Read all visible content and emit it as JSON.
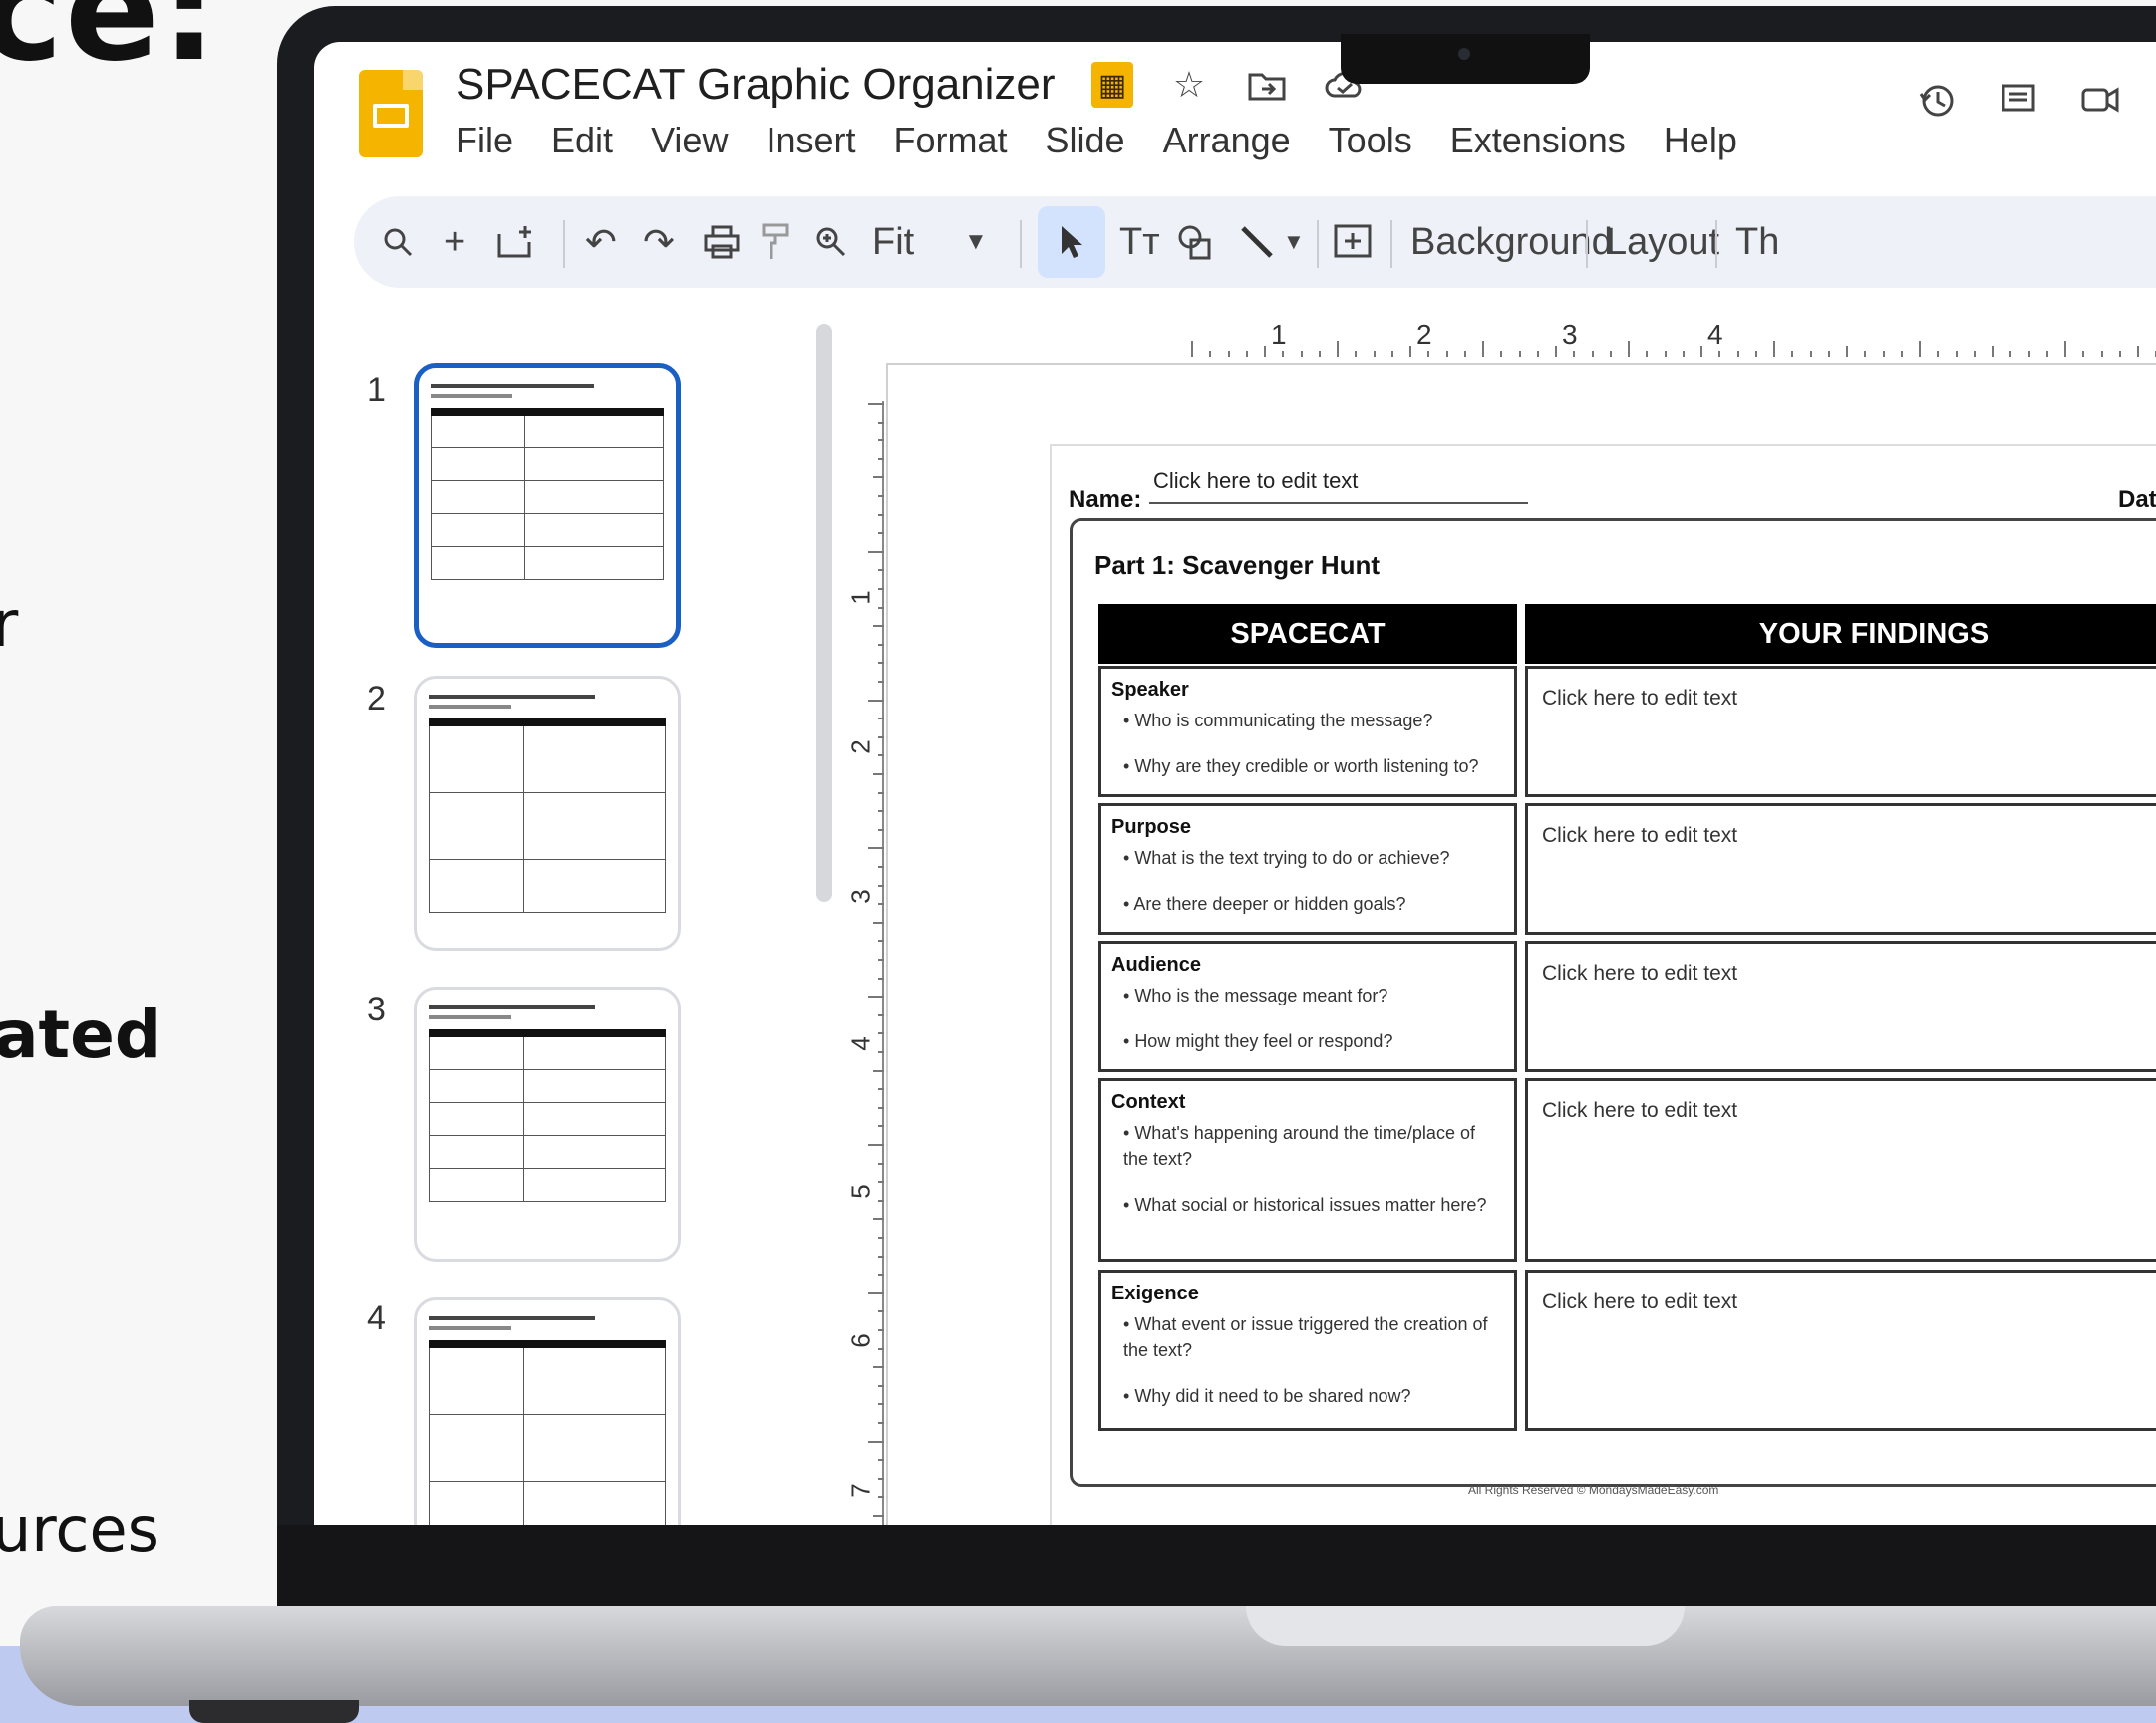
{
  "side_text": {
    "top": "ce:",
    "r": "r",
    "ated": "ated",
    "urces": "urces"
  },
  "app": {
    "title": "SPACECAT Graphic Organizer",
    "menu": [
      "File",
      "Edit",
      "View",
      "Insert",
      "Format",
      "Slide",
      "Arrange",
      "Tools",
      "Extensions",
      "Help"
    ]
  },
  "toolbar": {
    "zoom_label": "Fit",
    "background_label": "Background",
    "layout_label": "Layout",
    "theme_label": "Th"
  },
  "filmstrip": {
    "numbers": [
      "1",
      "2",
      "3",
      "4"
    ]
  },
  "rulers": {
    "h": [
      "1",
      "2",
      "3",
      "4"
    ],
    "v": [
      "1",
      "2",
      "3",
      "4",
      "5",
      "6",
      "7"
    ]
  },
  "slide": {
    "name_label": "Name:",
    "name_value": "Click here to edit text",
    "date_label": "Dat",
    "part_title": "Part 1: Scavenger Hunt",
    "col_left": "SPACECAT",
    "col_right": "YOUR FINDINGS",
    "rows": [
      {
        "cat": "Speaker",
        "q1": "Who is communicating the message?",
        "q2": "Why are they credible or worth listening to?",
        "finding": "Click here to edit text"
      },
      {
        "cat": "Purpose",
        "q1": "What is the text trying to do or achieve?",
        "q2": "Are there deeper or hidden goals?",
        "finding": "Click here to edit text"
      },
      {
        "cat": "Audience",
        "q1": "Who is the message meant for?",
        "q2": "How might they feel or respond?",
        "finding": "Click here to edit text"
      },
      {
        "cat": "Context",
        "q1": "What's happening around the time/place of the text?",
        "q2": "What social or historical issues matter here?",
        "finding": "Click here to edit text"
      },
      {
        "cat": "Exigence",
        "q1": "What event or issue triggered the creation of the text?",
        "q2": "Why did it need to be shared now?",
        "finding": "Click here to edit text"
      }
    ],
    "footer": "All Rights Reserved © MondaysMadeEasy.com"
  }
}
